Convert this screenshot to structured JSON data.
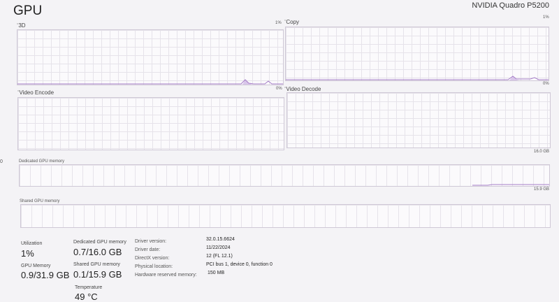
{
  "header": {
    "title": "GPU",
    "device_name": "NVIDIA Quadro P5200"
  },
  "edge_marker": "0",
  "engines": [
    {
      "label": "3D",
      "max": "1%",
      "min": "0%"
    },
    {
      "label": "Copy",
      "max": "1%",
      "min": "0%"
    },
    {
      "label": "Video Encode"
    },
    {
      "label": "Video Decode"
    }
  ],
  "dedicated_graph": {
    "label": "Dedicated GPU memory",
    "max": "16.0 GB",
    "min": "15.9 GB"
  },
  "shared_graph": {
    "label": "Shared GPU memory"
  },
  "stats": {
    "utilization": {
      "label": "Utilization",
      "value": "1%"
    },
    "dedicated": {
      "label": "Dedicated GPU memory",
      "value": "0.7/16.0 GB"
    },
    "gpu_memory": {
      "label": "GPU Memory",
      "value": "0.9/31.9 GB"
    },
    "shared": {
      "label": "Shared GPU memory",
      "value": "0.1/15.9 GB"
    },
    "temperature": {
      "label": "Temperature",
      "value": "49 °C"
    }
  },
  "info": [
    {
      "label": "Driver version:",
      "value": "32.0.15.6624"
    },
    {
      "label": "Driver date:",
      "value": "11/22/2024"
    },
    {
      "label": "DirectX version:",
      "value": "12 (FL 12.1)"
    },
    {
      "label": "Physical location:",
      "value": "PCI bus 1, device 0, function 0"
    },
    {
      "label": "Hardware reserved memory:",
      "value": "150 MB"
    }
  ],
  "colors": {
    "accent": "#a67ec8",
    "grid": "#e6e3ea",
    "border": "#cfc8d6"
  }
}
